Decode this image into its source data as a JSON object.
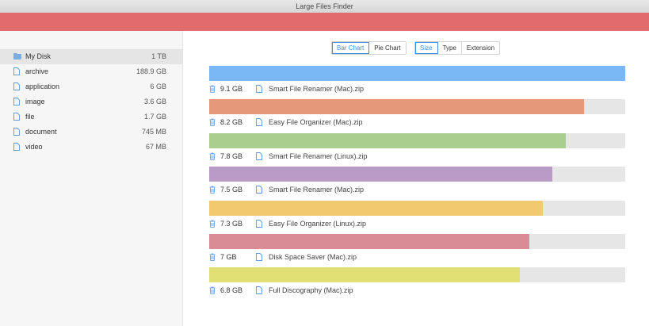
{
  "window": {
    "title": "Large Files Finder"
  },
  "sidebar": {
    "items": [
      {
        "label": "My Disk",
        "size": "1 TB",
        "icon": "folder-icon",
        "selected": true
      },
      {
        "label": "archive",
        "size": "188.9 GB",
        "icon": "file-icon"
      },
      {
        "label": "application",
        "size": "6 GB",
        "icon": "file-icon"
      },
      {
        "label": "image",
        "size": "3.6 GB",
        "icon": "file-icon"
      },
      {
        "label": "file",
        "size": "1.7 GB",
        "icon": "file-icon"
      },
      {
        "label": "document",
        "size": "745 MB",
        "icon": "file-icon"
      },
      {
        "label": "video",
        "size": "67 MB",
        "icon": "file-icon"
      }
    ]
  },
  "view_toggle": {
    "bar_chart": "Bar Chart",
    "pie_chart": "Pie Chart",
    "active": "Bar Chart"
  },
  "group_toggle": {
    "size": "Size",
    "type": "Type",
    "extension": "Extension",
    "active": "Size"
  },
  "files": [
    {
      "size": "9.1 GB",
      "name": "Smart File Renamer (Mac).zip",
      "fraction": 1.0,
      "color": "#7ab8f5"
    },
    {
      "size": "8.2 GB",
      "name": "Easy File Organizer (Mac).zip",
      "fraction": 0.901,
      "color": "#e5997a"
    },
    {
      "size": "7.8 GB",
      "name": "Smart File Renamer (Linux).zip",
      "fraction": 0.857,
      "color": "#a9cf8e"
    },
    {
      "size": "7.5 GB",
      "name": "Smart File Renamer (Mac).zip",
      "fraction": 0.824,
      "color": "#ba9bc7"
    },
    {
      "size": "7.3 GB",
      "name": "Easy File Organizer (Linux).zip",
      "fraction": 0.802,
      "color": "#f2c96f"
    },
    {
      "size": "7 GB",
      "name": "Disk Space Saver (Mac).zip",
      "fraction": 0.769,
      "color": "#d98c96"
    },
    {
      "size": "6.8 GB",
      "name": "Full Discography (Mac).zip",
      "fraction": 0.747,
      "color": "#e1e075"
    }
  ],
  "colors": {
    "accent": "#3a8ee6",
    "header_bar": "#e06c6e"
  }
}
